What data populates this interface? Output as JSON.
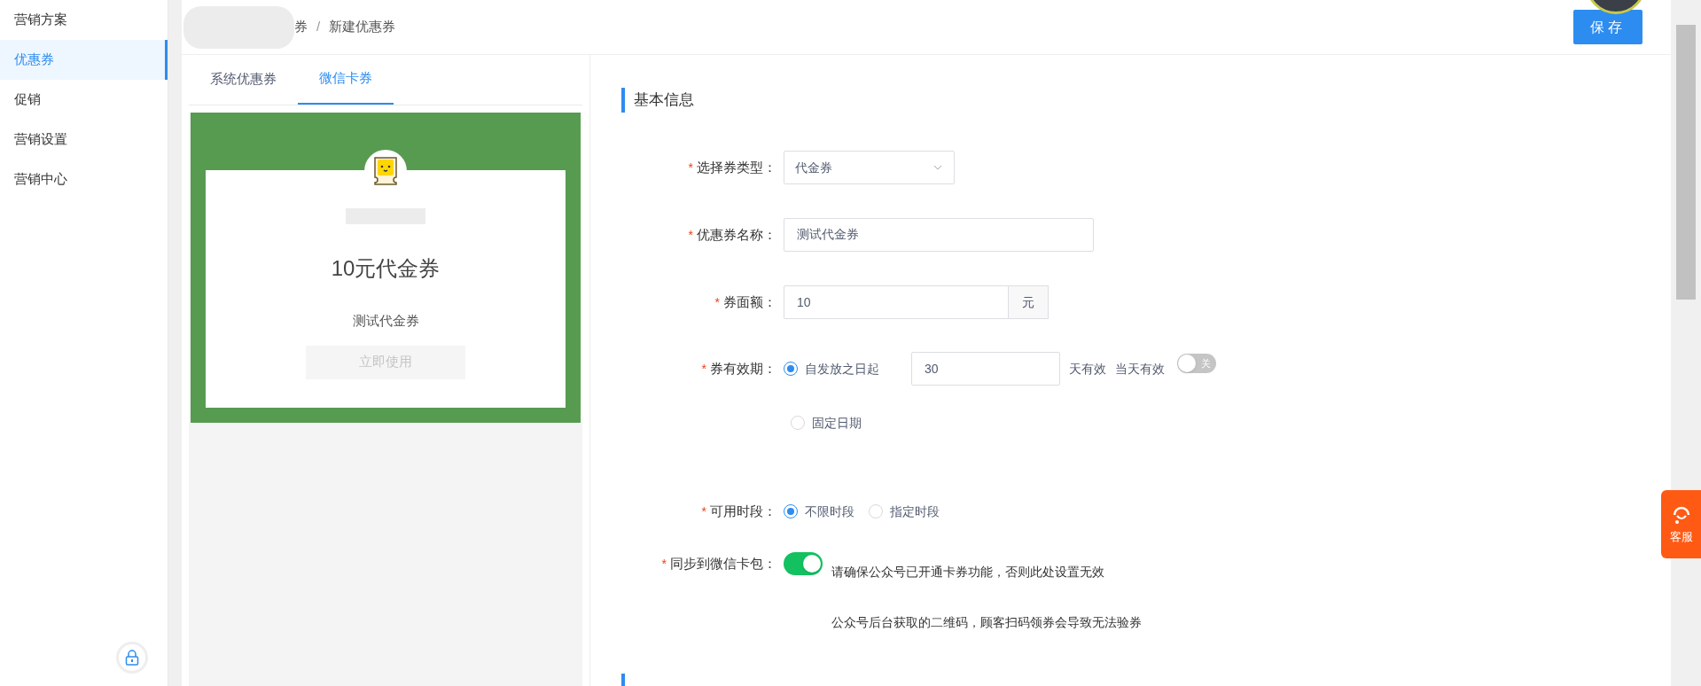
{
  "sidebar": {
    "items": [
      {
        "label": "营销方案",
        "selected": false
      },
      {
        "label": "优惠券",
        "selected": true
      },
      {
        "label": "促销",
        "selected": false
      },
      {
        "label": "营销设置",
        "selected": false
      },
      {
        "label": "营销中心",
        "selected": false
      }
    ]
  },
  "breadcrumb": {
    "items": [
      "券",
      "新建优惠券"
    ],
    "separator": "/"
  },
  "save_button": "保存",
  "tabs": [
    {
      "label": "系统优惠券",
      "selected": false
    },
    {
      "label": "微信卡券",
      "selected": true
    }
  ],
  "preview": {
    "title": "10元代金券",
    "subtitle": "测试代金券",
    "button": "立即使用"
  },
  "form": {
    "section_title": "基本信息",
    "fields": [
      {
        "kind": "select",
        "label": "选择券类型：",
        "required_mark": "*",
        "value": "代金券"
      },
      {
        "kind": "text",
        "label": "优惠券名称：",
        "required_mark": "*",
        "value": "测试代金券"
      },
      {
        "kind": "addon",
        "label": "券面额：",
        "required_mark": "*",
        "value": "10",
        "suffix": "元"
      },
      {
        "kind": "validity",
        "label": "券有效期：",
        "required_mark": "*",
        "options": [
          {
            "label": "自发放之日起",
            "selected": true,
            "value": "30",
            "suffix": "天有效",
            "extra": "当天有效",
            "toggle_on": false,
            "toggle_text": "关"
          },
          {
            "label": "固定日期",
            "selected": false
          }
        ]
      },
      {
        "kind": "radios",
        "label": "可用时段：",
        "required_mark": "*",
        "options": [
          {
            "label": "不限时段",
            "selected": true
          },
          {
            "label": "指定时段",
            "selected": false
          }
        ]
      },
      {
        "kind": "toggle",
        "label": "同步到微信卡包：",
        "required_mark": "*",
        "on": true,
        "notes": [
          "请确保公众号已开通卡券功能，否则此处设置无效",
          "公众号后台获取的二维码，顾客扫码领券会导致无法验券"
        ]
      }
    ]
  },
  "chat_button": "客服"
}
